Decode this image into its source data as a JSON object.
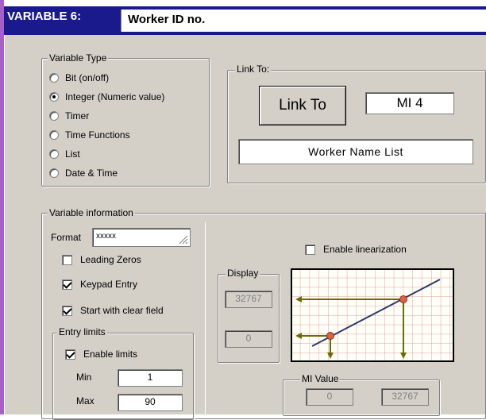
{
  "header": {
    "variable_label": "VARIABLE 6:",
    "variable_name": "Worker ID no."
  },
  "variable_type": {
    "legend": "Variable Type",
    "options": [
      {
        "label": "Bit (on/off)",
        "selected": false
      },
      {
        "label": "Integer (Numeric value)",
        "selected": true
      },
      {
        "label": "Timer",
        "selected": false
      },
      {
        "label": "Time Functions",
        "selected": false
      },
      {
        "label": "List",
        "selected": false
      },
      {
        "label": "Date & Time",
        "selected": false
      }
    ]
  },
  "link_to": {
    "legend": "Link To:",
    "button_label": "Link To",
    "target_value": "MI  4",
    "list_name": "Worker Name List"
  },
  "variable_info": {
    "legend": "Variable information",
    "format_label": "Format",
    "format_value": "xxxxx",
    "leading_zeros": {
      "label": "Leading Zeros",
      "checked": false
    },
    "keypad_entry": {
      "label": "Keypad Entry",
      "checked": true
    },
    "start_clear": {
      "label": "Start with clear field",
      "checked": true
    },
    "entry_limits": {
      "legend": "Entry limits",
      "enable": {
        "label": "Enable limits",
        "checked": true
      },
      "min_label": "Min",
      "min_value": "1",
      "max_label": "Max",
      "max_value": "90"
    }
  },
  "linearization": {
    "enable": {
      "label": "Enable linearization",
      "checked": false
    },
    "display_legend": "Display",
    "display_high": "32767",
    "display_low": "0",
    "mi_legend": "MI Value",
    "mi_low": "0",
    "mi_high": "32767"
  },
  "colors": {
    "title_bg": "#1a1a8c",
    "accent_strip": "#a85ec8",
    "dialog_bg": "#d4d0c8",
    "graph_line": "#2a3a6a",
    "graph_arrow": "#6b6b00",
    "graph_point": "#e06040"
  }
}
